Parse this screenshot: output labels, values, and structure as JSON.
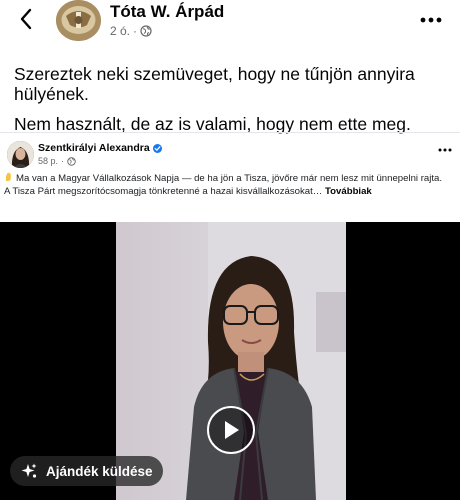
{
  "header": {
    "author_name": "Tóta W. Árpád",
    "time": "2 ó.",
    "separator": "·"
  },
  "post": {
    "paragraphs": [
      "Szereztek neki szemüveget, hogy ne tűnjön annyira hülyének.",
      "Nem használt, de az is valami, hogy nem ette meg."
    ]
  },
  "shared_post": {
    "author_name": "Szentkirályi Alexandra",
    "time": "58 p.",
    "separator": "·",
    "text_line1": "Ma van a Magyar Vállalkozások Napja — de ha jön a Tisza, jövőre már nem lesz mit ünnepelni rajta.",
    "text_line2": "A Tisza Párt megszorítócsomagja tönkretenné a hazai kisvállalkozásokat…",
    "see_more": "Továbbiak"
  },
  "gift_button": {
    "label": "Ajándék küldése"
  },
  "icons": {
    "back": "chevron-left-icon",
    "more": "more-horizontal-icon",
    "globe": "globe-icon",
    "verified": "verified-badge-icon",
    "play": "play-icon",
    "gift": "gift-sparkle-icon"
  },
  "colors": {
    "text": "#050505",
    "secondary_text": "#65676b",
    "verified_blue": "#1877f2",
    "video_background": "#000000"
  }
}
